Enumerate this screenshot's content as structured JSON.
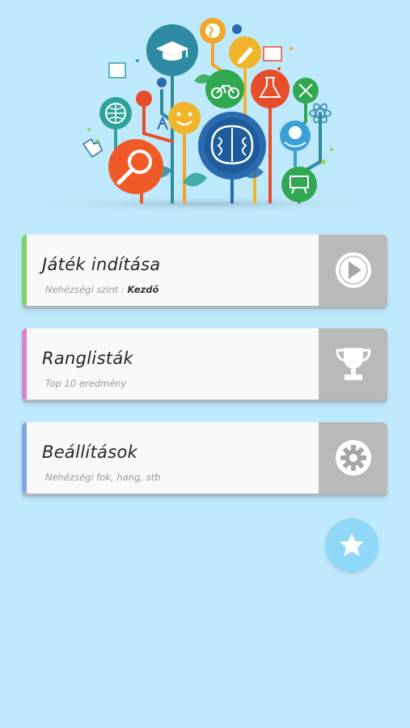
{
  "menu": {
    "start": {
      "title": "Játék indítása",
      "sub_prefix": "Nehézségi szint : ",
      "sub_value": "Kezdő",
      "accent": "#7bd36b"
    },
    "rankings": {
      "title": "Ranglisták",
      "sub": "Top 10 eredmény",
      "accent": "#d983c9"
    },
    "settings": {
      "title": "Beállítások",
      "sub": "Nehézségi fok, hang, stb",
      "accent": "#7ea8e4"
    }
  },
  "icons": {
    "start": "play-icon",
    "rankings": "trophy-icon",
    "settings": "gear-icon",
    "favorite": "star-icon",
    "hero": "education-tree-illustration"
  },
  "colors": {
    "background": "#bfe9fc",
    "side_panel": "#b9b9b9",
    "favorite_button": "#8fd8f8"
  }
}
